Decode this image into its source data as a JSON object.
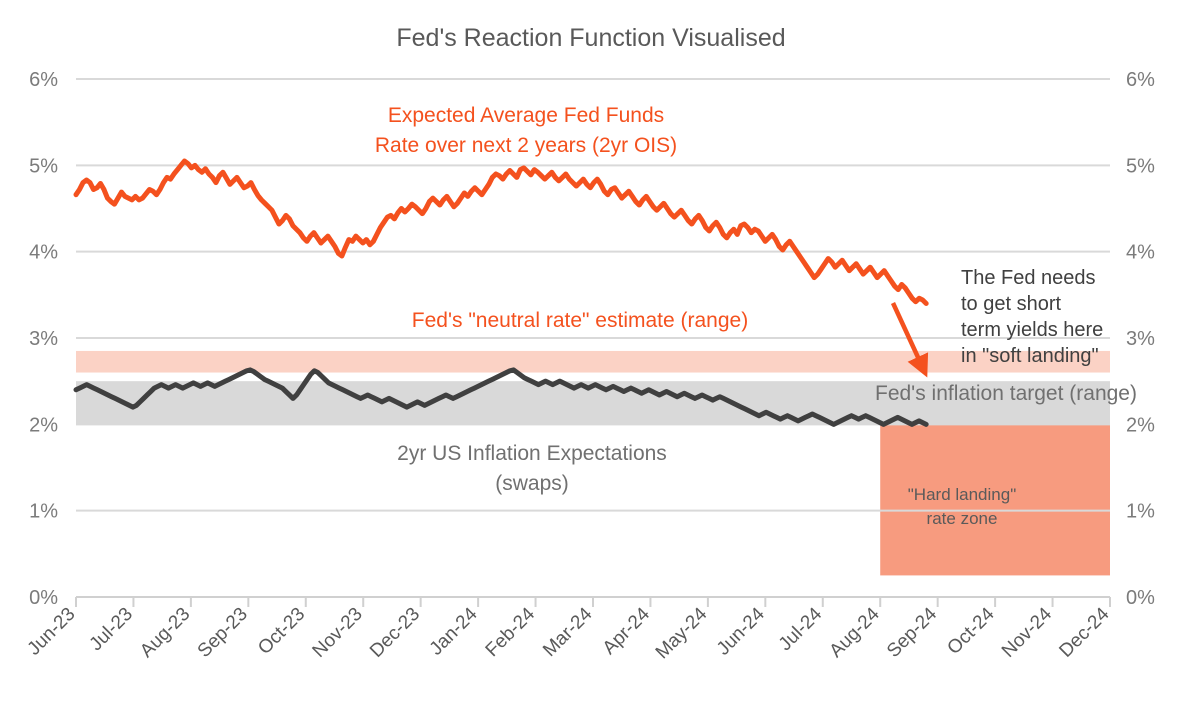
{
  "chart_data": {
    "type": "line",
    "title": "Fed's Reaction Function Visualised",
    "xlabel": "",
    "ylabel": "",
    "ylim": [
      0,
      6
    ],
    "ytick_labels": [
      "0%",
      "1%",
      "2%",
      "3%",
      "4%",
      "5%",
      "6%"
    ],
    "ytick_values": [
      0,
      1,
      2,
      3,
      4,
      5,
      6
    ],
    "grid": true,
    "legend": "annotations",
    "x_tick_labels": [
      "Jun-23",
      "Jul-23",
      "Aug-23",
      "Sep-23",
      "Oct-23",
      "Nov-23",
      "Dec-23",
      "Jan-24",
      "Feb-24",
      "Mar-24",
      "Apr-24",
      "May-24",
      "Jun-24",
      "Jul-24",
      "Aug-24",
      "Sep-24",
      "Oct-24",
      "Nov-24",
      "Dec-24"
    ],
    "x_start": "Jun-23",
    "x_end": "Dec-24",
    "series": [
      {
        "name": "Expected Average Fed Funds Rate over next 2 years (2yr OIS)",
        "color": "#f4511e",
        "values": [
          4.66,
          4.72,
          4.8,
          4.83,
          4.8,
          4.72,
          4.74,
          4.79,
          4.72,
          4.62,
          4.58,
          4.55,
          4.62,
          4.69,
          4.64,
          4.62,
          4.6,
          4.64,
          4.6,
          4.62,
          4.67,
          4.72,
          4.7,
          4.66,
          4.72,
          4.8,
          4.86,
          4.84,
          4.9,
          4.95,
          5.0,
          5.05,
          5.02,
          4.97,
          5.0,
          4.95,
          4.92,
          4.96,
          4.9,
          4.86,
          4.8,
          4.88,
          4.92,
          4.85,
          4.78,
          4.82,
          4.86,
          4.8,
          4.74,
          4.76,
          4.8,
          4.72,
          4.65,
          4.6,
          4.56,
          4.52,
          4.48,
          4.4,
          4.32,
          4.36,
          4.42,
          4.38,
          4.3,
          4.26,
          4.22,
          4.16,
          4.12,
          4.18,
          4.22,
          4.16,
          4.1,
          4.14,
          4.18,
          4.12,
          4.06,
          3.98,
          3.95,
          4.05,
          4.14,
          4.12,
          4.18,
          4.14,
          4.1,
          4.14,
          4.08,
          4.12,
          4.2,
          4.28,
          4.34,
          4.4,
          4.42,
          4.38,
          4.45,
          4.5,
          4.46,
          4.5,
          4.55,
          4.52,
          4.48,
          4.44,
          4.5,
          4.58,
          4.62,
          4.58,
          4.54,
          4.6,
          4.64,
          4.58,
          4.52,
          4.56,
          4.62,
          4.68,
          4.64,
          4.7,
          4.74,
          4.7,
          4.66,
          4.72,
          4.78,
          4.86,
          4.9,
          4.88,
          4.84,
          4.9,
          4.94,
          4.9,
          4.86,
          4.95,
          4.97,
          4.93,
          4.89,
          4.95,
          4.92,
          4.88,
          4.84,
          4.88,
          4.92,
          4.86,
          4.82,
          4.86,
          4.9,
          4.84,
          4.8,
          4.76,
          4.8,
          4.84,
          4.78,
          4.74,
          4.8,
          4.84,
          4.78,
          4.7,
          4.66,
          4.72,
          4.74,
          4.68,
          4.62,
          4.66,
          4.7,
          4.64,
          4.58,
          4.54,
          4.6,
          4.64,
          4.58,
          4.52,
          4.48,
          4.52,
          4.56,
          4.5,
          4.44,
          4.4,
          4.44,
          4.48,
          4.42,
          4.36,
          4.32,
          4.38,
          4.42,
          4.36,
          4.28,
          4.24,
          4.3,
          4.34,
          4.28,
          4.2,
          4.16,
          4.22,
          4.26,
          4.2,
          4.3,
          4.32,
          4.28,
          4.22,
          4.26,
          4.24,
          4.18,
          4.12,
          4.16,
          4.2,
          4.14,
          4.06,
          4.02,
          4.08,
          4.12,
          4.06,
          4.0,
          3.94,
          3.88,
          3.82,
          3.76,
          3.7,
          3.74,
          3.8,
          3.86,
          3.92,
          3.88,
          3.82,
          3.86,
          3.9,
          3.84,
          3.78,
          3.82,
          3.86,
          3.8,
          3.74,
          3.78,
          3.82,
          3.76,
          3.7,
          3.74,
          3.78,
          3.72,
          3.66,
          3.6,
          3.56,
          3.62,
          3.58,
          3.52,
          3.46,
          3.42,
          3.46,
          3.44,
          3.4
        ]
      },
      {
        "name": "2yr US Inflation Expectations (swaps)",
        "color": "#404040",
        "values": [
          2.4,
          2.42,
          2.44,
          2.46,
          2.44,
          2.42,
          2.4,
          2.38,
          2.36,
          2.34,
          2.32,
          2.3,
          2.28,
          2.26,
          2.24,
          2.22,
          2.2,
          2.22,
          2.26,
          2.3,
          2.34,
          2.38,
          2.42,
          2.44,
          2.46,
          2.44,
          2.42,
          2.44,
          2.46,
          2.44,
          2.42,
          2.44,
          2.46,
          2.48,
          2.46,
          2.44,
          2.46,
          2.48,
          2.46,
          2.44,
          2.46,
          2.48,
          2.5,
          2.52,
          2.54,
          2.56,
          2.58,
          2.6,
          2.62,
          2.63,
          2.61,
          2.58,
          2.55,
          2.52,
          2.5,
          2.48,
          2.46,
          2.44,
          2.42,
          2.38,
          2.34,
          2.3,
          2.34,
          2.4,
          2.46,
          2.52,
          2.58,
          2.62,
          2.6,
          2.56,
          2.52,
          2.48,
          2.46,
          2.44,
          2.42,
          2.4,
          2.38,
          2.36,
          2.34,
          2.32,
          2.3,
          2.32,
          2.34,
          2.32,
          2.3,
          2.28,
          2.26,
          2.28,
          2.3,
          2.28,
          2.26,
          2.24,
          2.22,
          2.2,
          2.22,
          2.24,
          2.26,
          2.24,
          2.22,
          2.24,
          2.26,
          2.28,
          2.3,
          2.32,
          2.34,
          2.32,
          2.3,
          2.32,
          2.34,
          2.36,
          2.38,
          2.4,
          2.42,
          2.44,
          2.46,
          2.48,
          2.5,
          2.52,
          2.54,
          2.56,
          2.58,
          2.6,
          2.62,
          2.63,
          2.6,
          2.57,
          2.54,
          2.52,
          2.5,
          2.48,
          2.46,
          2.48,
          2.5,
          2.48,
          2.46,
          2.48,
          2.5,
          2.48,
          2.46,
          2.44,
          2.42,
          2.44,
          2.46,
          2.44,
          2.42,
          2.44,
          2.46,
          2.44,
          2.42,
          2.4,
          2.42,
          2.44,
          2.42,
          2.4,
          2.38,
          2.4,
          2.42,
          2.4,
          2.38,
          2.36,
          2.38,
          2.4,
          2.38,
          2.36,
          2.34,
          2.36,
          2.38,
          2.36,
          2.34,
          2.32,
          2.34,
          2.36,
          2.34,
          2.32,
          2.3,
          2.32,
          2.34,
          2.32,
          2.3,
          2.28,
          2.3,
          2.32,
          2.3,
          2.28,
          2.26,
          2.24,
          2.22,
          2.2,
          2.18,
          2.16,
          2.14,
          2.12,
          2.1,
          2.12,
          2.14,
          2.12,
          2.1,
          2.08,
          2.06,
          2.08,
          2.1,
          2.08,
          2.06,
          2.04,
          2.06,
          2.08,
          2.1,
          2.12,
          2.1,
          2.08,
          2.06,
          2.04,
          2.02,
          2.0,
          2.02,
          2.04,
          2.06,
          2.08,
          2.1,
          2.08,
          2.06,
          2.08,
          2.1,
          2.08,
          2.06,
          2.04,
          2.02,
          2.0,
          2.02,
          2.04,
          2.06,
          2.08,
          2.06,
          2.04,
          2.02,
          2.0,
          2.02,
          2.04,
          2.02,
          2.0
        ]
      }
    ],
    "bands": [
      {
        "name": "Fed's neutral rate estimate (range)",
        "y0": 2.6,
        "y1": 2.85,
        "color": "#fbd2c5",
        "x_from": "Jun-23",
        "x_to": "Dec-24"
      },
      {
        "name": "Fed's inflation target (range)",
        "y0": 2.0,
        "y1": 2.5,
        "color": "#d9d9d9",
        "x_from": "Jun-23",
        "x_to": "Dec-24"
      },
      {
        "name": "Hard landing rate zone",
        "y0": 0.25,
        "y1": 2.0,
        "color": "#f79b7f",
        "x_from": "Aug-24",
        "x_to": "Dec-24"
      }
    ],
    "annotations": [
      {
        "id": "ois-label",
        "text_lines": [
          "Expected Average Fed Funds",
          "Rate over next 2 years (2yr OIS)"
        ],
        "color": "#f4511e"
      },
      {
        "id": "neutral-label",
        "text_lines": [
          "Fed's \"neutral rate\" estimate (range)"
        ],
        "color": "#f4511e"
      },
      {
        "id": "inflation-target-label",
        "text_lines": [
          "Fed's inflation target (range)"
        ],
        "color": "#707070"
      },
      {
        "id": "inflation-expectations-label",
        "text_lines": [
          "2yr US Inflation Expectations",
          "(swaps)"
        ],
        "color": "#707070"
      },
      {
        "id": "soft-landing-callout",
        "text_lines": [
          "The Fed needs",
          "to get short",
          "term yields here",
          "in \"soft landing\""
        ],
        "color": "#262626"
      },
      {
        "id": "hard-landing-zone-label",
        "text_lines": [
          "\"Hard landing\"",
          "rate zone"
        ],
        "color": "#5a5a5a"
      }
    ]
  },
  "title": "Fed's Reaction Function Visualised",
  "axis": {
    "left_ticks": [
      "6%",
      "5%",
      "4%",
      "3%",
      "2%",
      "1%",
      "0%"
    ],
    "right_ticks": [
      "6%",
      "5%",
      "4%",
      "3%",
      "2%",
      "1%",
      "0%"
    ],
    "x_ticks": [
      "Jun-23",
      "Jul-23",
      "Aug-23",
      "Sep-23",
      "Oct-23",
      "Nov-23",
      "Dec-23",
      "Jan-24",
      "Feb-24",
      "Mar-24",
      "Apr-24",
      "May-24",
      "Jun-24",
      "Jul-24",
      "Aug-24",
      "Sep-24",
      "Oct-24",
      "Nov-24",
      "Dec-24"
    ]
  },
  "labels": {
    "ois_line1": "Expected Average Fed Funds",
    "ois_line2": "Rate over next 2 years (2yr OIS)",
    "neutral_rate": "Fed's \"neutral rate\" estimate (range)",
    "inflation_target": "Fed's inflation target (range)",
    "inflation_exp_line1": "2yr US Inflation Expectations",
    "inflation_exp_line2": "(swaps)",
    "callout_line1": "The Fed needs",
    "callout_line2": "to get short",
    "callout_line3": "term yields here",
    "callout_line4": "in \"soft landing\"",
    "hard_zone_line1": "\"Hard landing\"",
    "hard_zone_line2": "rate zone"
  },
  "colors": {
    "ois_line": "#f4511e",
    "inflation_line": "#404040",
    "neutral_band": "#fbd2c5",
    "target_band": "#d9d9d9",
    "hard_landing_band": "#f79b7f",
    "grid": "#d9d9d9",
    "title_text": "#595959",
    "tick_text": "#7b7b7b"
  }
}
